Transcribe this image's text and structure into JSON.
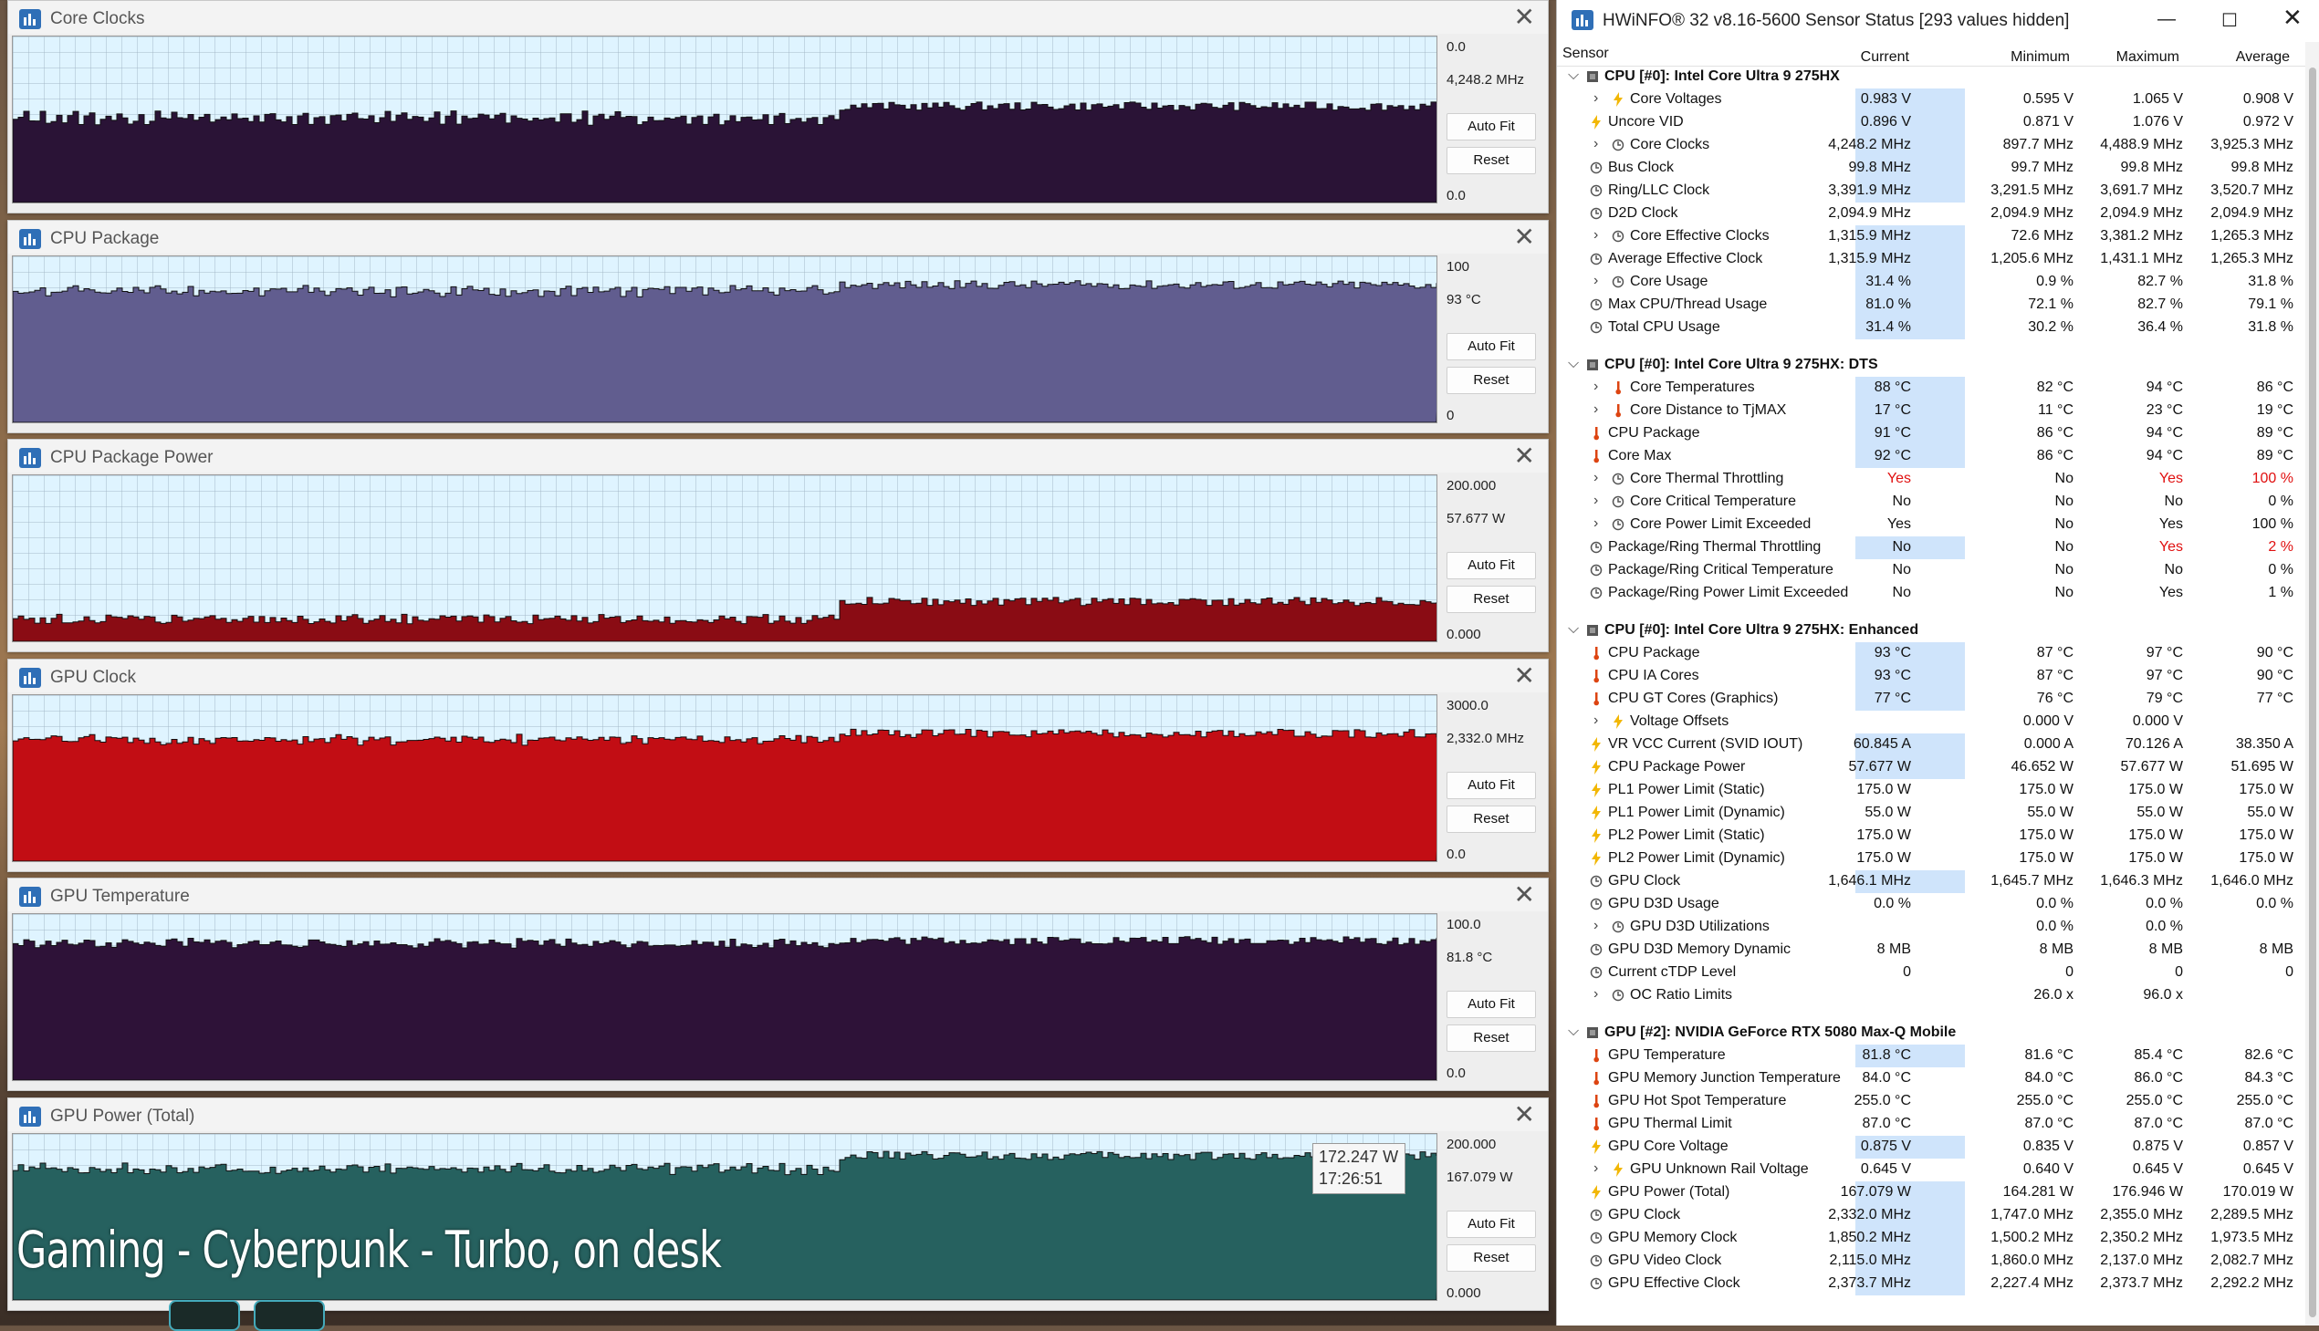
{
  "caption": "Gaming - Cyberpunk - Turbo, on desk",
  "graphs": [
    {
      "title": "Core Clocks",
      "max_label": "0.0",
      "current_label": "4,248.2 MHz",
      "min_label": "0.0",
      "fill": "#2a1336",
      "series": [
        0.49,
        0.51,
        0.53,
        0.5,
        0.58
      ]
    },
    {
      "title": "CPU Package",
      "max_label": "100",
      "current_label": "93 °C",
      "min_label": "0",
      "fill": "#615d8f",
      "series": [
        0.78,
        0.79,
        0.8,
        0.79,
        0.83
      ]
    },
    {
      "title": "CPU Package Power",
      "max_label": "200.000",
      "current_label": "57.677 W",
      "min_label": "0.000",
      "fill": "#8a0c14",
      "series": [
        0.13,
        0.13,
        0.14,
        0.13,
        0.24
      ]
    },
    {
      "title": "GPU Clock",
      "max_label": "3000.0",
      "current_label": "2,332.0 MHz",
      "min_label": "0.0",
      "fill": "#c20d14",
      "series": [
        0.72,
        0.73,
        0.74,
        0.73,
        0.77
      ]
    },
    {
      "title": "GPU Temperature",
      "max_label": "100.0",
      "current_label": "81.8 °C",
      "min_label": "0.0",
      "fill": "#2e1238",
      "series": [
        0.82,
        0.82,
        0.83,
        0.82,
        0.84
      ]
    },
    {
      "title": "GPU Power (Total)",
      "max_label": "200.000",
      "current_label": "167.079 W",
      "min_label": "0.000",
      "fill": "#26615f",
      "series": [
        0.78,
        0.79,
        0.8,
        0.78,
        0.87
      ]
    }
  ],
  "buttons": {
    "autofit": "Auto Fit",
    "reset": "Reset"
  },
  "tooltip": {
    "line1": "172.247 W",
    "line2": "17:26:51"
  },
  "hwinfo": {
    "title": "HWiNFO® 32 v8.16-5600 Sensor Status [293 values hidden]",
    "headers": {
      "sensor": "Sensor",
      "current": "Current",
      "minimum": "Minimum",
      "maximum": "Maximum",
      "average": "Average"
    },
    "rows": [
      {
        "g": 1,
        "name": "CPU [#0]: Intel Core Ultra 9 275HX"
      },
      {
        "e": 1,
        "ic": "bolt",
        "name": "Core Voltages",
        "c": "0.983 V",
        "mn": "0.595 V",
        "mx": "1.065 V",
        "av": "0.908 V",
        "hl": 1
      },
      {
        "ic": "bolt",
        "name": "Uncore VID",
        "c": "0.896 V",
        "mn": "0.871 V",
        "mx": "1.076 V",
        "av": "0.972 V",
        "hl": 1
      },
      {
        "e": 1,
        "ic": "clock",
        "name": "Core Clocks",
        "c": "4,248.2 MHz",
        "mn": "897.7 MHz",
        "mx": "4,488.9 MHz",
        "av": "3,925.3 MHz",
        "hl": 1
      },
      {
        "ic": "clock",
        "name": "Bus Clock",
        "c": "99.8 MHz",
        "mn": "99.7 MHz",
        "mx": "99.8 MHz",
        "av": "99.8 MHz",
        "hl": 1
      },
      {
        "ic": "clock",
        "name": "Ring/LLC Clock",
        "c": "3,391.9 MHz",
        "mn": "3,291.5 MHz",
        "mx": "3,691.7 MHz",
        "av": "3,520.7 MHz",
        "hl": 1
      },
      {
        "ic": "clock",
        "name": "D2D Clock",
        "c": "2,094.9 MHz",
        "mn": "2,094.9 MHz",
        "mx": "2,094.9 MHz",
        "av": "2,094.9 MHz"
      },
      {
        "e": 1,
        "ic": "clock",
        "name": "Core Effective Clocks",
        "c": "1,315.9 MHz",
        "mn": "72.6 MHz",
        "mx": "3,381.2 MHz",
        "av": "1,265.3 MHz",
        "hl": 1
      },
      {
        "ic": "clock",
        "name": "Average Effective Clock",
        "c": "1,315.9 MHz",
        "mn": "1,205.6 MHz",
        "mx": "1,431.1 MHz",
        "av": "1,265.3 MHz",
        "hl": 1
      },
      {
        "e": 1,
        "ic": "clock",
        "name": "Core Usage",
        "c": "31.4 %",
        "mn": "0.9 %",
        "mx": "82.7 %",
        "av": "31.8 %",
        "hl": 1
      },
      {
        "ic": "clock",
        "name": "Max CPU/Thread Usage",
        "c": "81.0 %",
        "mn": "72.1 %",
        "mx": "82.7 %",
        "av": "79.1 %",
        "hl": 1
      },
      {
        "ic": "clock",
        "name": "Total CPU Usage",
        "c": "31.4 %",
        "mn": "30.2 %",
        "mx": "36.4 %",
        "av": "31.8 %",
        "hl": 1
      },
      {
        "sp": 1
      },
      {
        "g": 1,
        "name": "CPU [#0]: Intel Core Ultra 9 275HX: DTS"
      },
      {
        "e": 1,
        "ic": "therm",
        "name": "Core Temperatures",
        "c": "88 °C",
        "mn": "82 °C",
        "mx": "94 °C",
        "av": "86 °C",
        "hl": 1
      },
      {
        "e": 1,
        "ic": "therm",
        "name": "Core Distance to TjMAX",
        "c": "17 °C",
        "mn": "11 °C",
        "mx": "23 °C",
        "av": "19 °C",
        "hl": 1
      },
      {
        "ic": "therm",
        "name": "CPU Package",
        "c": "91 °C",
        "mn": "86 °C",
        "mx": "94 °C",
        "av": "89 °C",
        "hl": 1
      },
      {
        "ic": "therm",
        "name": "Core Max",
        "c": "92 °C",
        "mn": "86 °C",
        "mx": "94 °C",
        "av": "89 °C",
        "hl": 1
      },
      {
        "e": 1,
        "ic": "clock",
        "name": "Core Thermal Throttling",
        "c": "Yes",
        "mn": "No",
        "mx": "Yes",
        "av": "100 %",
        "red": [
          1,
          0,
          1,
          1
        ]
      },
      {
        "e": 1,
        "ic": "clock",
        "name": "Core Critical Temperature",
        "c": "No",
        "mn": "No",
        "mx": "No",
        "av": "0 %"
      },
      {
        "e": 1,
        "ic": "clock",
        "name": "Core Power Limit Exceeded",
        "c": "Yes",
        "mn": "No",
        "mx": "Yes",
        "av": "100 %"
      },
      {
        "ic": "clock",
        "name": "Package/Ring Thermal Throttling",
        "c": "No",
        "mn": "No",
        "mx": "Yes",
        "av": "2 %",
        "hl": 1,
        "red": [
          0,
          0,
          1,
          1
        ]
      },
      {
        "ic": "clock",
        "name": "Package/Ring Critical Temperature",
        "c": "No",
        "mn": "No",
        "mx": "No",
        "av": "0 %"
      },
      {
        "ic": "clock",
        "name": "Package/Ring Power Limit Exceeded",
        "c": "No",
        "mn": "No",
        "mx": "Yes",
        "av": "1 %"
      },
      {
        "sp": 1
      },
      {
        "g": 1,
        "name": "CPU [#0]: Intel Core Ultra 9 275HX: Enhanced"
      },
      {
        "ic": "therm",
        "name": "CPU Package",
        "c": "93 °C",
        "mn": "87 °C",
        "mx": "97 °C",
        "av": "90 °C",
        "hl": 1
      },
      {
        "ic": "therm",
        "name": "CPU IA Cores",
        "c": "93 °C",
        "mn": "87 °C",
        "mx": "97 °C",
        "av": "90 °C",
        "hl": 1
      },
      {
        "ic": "therm",
        "name": "CPU GT Cores (Graphics)",
        "c": "77 °C",
        "mn": "76 °C",
        "mx": "79 °C",
        "av": "77 °C",
        "hl": 1
      },
      {
        "e": 1,
        "ic": "bolt",
        "name": "Voltage Offsets",
        "c": "",
        "mn": "0.000 V",
        "mx": "0.000 V",
        "av": ""
      },
      {
        "ic": "bolt",
        "name": "VR VCC Current (SVID IOUT)",
        "c": "60.845 A",
        "mn": "0.000 A",
        "mx": "70.126 A",
        "av": "38.350 A",
        "hl": 1
      },
      {
        "ic": "bolt",
        "name": "CPU Package Power",
        "c": "57.677 W",
        "mn": "46.652 W",
        "mx": "57.677 W",
        "av": "51.695 W",
        "hl": 1
      },
      {
        "ic": "bolt",
        "name": "PL1 Power Limit (Static)",
        "c": "175.0 W",
        "mn": "175.0 W",
        "mx": "175.0 W",
        "av": "175.0 W"
      },
      {
        "ic": "bolt",
        "name": "PL1 Power Limit (Dynamic)",
        "c": "55.0 W",
        "mn": "55.0 W",
        "mx": "55.0 W",
        "av": "55.0 W"
      },
      {
        "ic": "bolt",
        "name": "PL2 Power Limit (Static)",
        "c": "175.0 W",
        "mn": "175.0 W",
        "mx": "175.0 W",
        "av": "175.0 W"
      },
      {
        "ic": "bolt",
        "name": "PL2 Power Limit (Dynamic)",
        "c": "175.0 W",
        "mn": "175.0 W",
        "mx": "175.0 W",
        "av": "175.0 W"
      },
      {
        "ic": "clock",
        "name": "GPU Clock",
        "c": "1,646.1 MHz",
        "mn": "1,645.7 MHz",
        "mx": "1,646.3 MHz",
        "av": "1,646.0 MHz",
        "hl": 1
      },
      {
        "ic": "clock",
        "name": "GPU D3D Usage",
        "c": "0.0 %",
        "mn": "0.0 %",
        "mx": "0.0 %",
        "av": "0.0 %"
      },
      {
        "e": 1,
        "ic": "clock",
        "name": "GPU D3D Utilizations",
        "c": "",
        "mn": "0.0 %",
        "mx": "0.0 %",
        "av": ""
      },
      {
        "ic": "clock",
        "name": "GPU D3D Memory Dynamic",
        "c": "8 MB",
        "mn": "8 MB",
        "mx": "8 MB",
        "av": "8 MB"
      },
      {
        "ic": "clock",
        "name": "Current cTDP Level",
        "c": "0",
        "mn": "0",
        "mx": "0",
        "av": "0"
      },
      {
        "e": 1,
        "ic": "clock",
        "name": "OC Ratio Limits",
        "c": "",
        "mn": "26.0 x",
        "mx": "96.0 x",
        "av": ""
      },
      {
        "sp": 1
      },
      {
        "g": 1,
        "name": "GPU [#2]: NVIDIA  GeForce RTX 5080 Max-Q Mobile"
      },
      {
        "ic": "therm",
        "name": "GPU Temperature",
        "c": "81.8 °C",
        "mn": "81.6 °C",
        "mx": "85.4 °C",
        "av": "82.6 °C",
        "hl": 1
      },
      {
        "ic": "therm",
        "name": "GPU Memory Junction Temperature",
        "c": "84.0 °C",
        "mn": "84.0 °C",
        "mx": "86.0 °C",
        "av": "84.3 °C"
      },
      {
        "ic": "therm",
        "name": "GPU Hot Spot Temperature",
        "c": "255.0 °C",
        "mn": "255.0 °C",
        "mx": "255.0 °C",
        "av": "255.0 °C"
      },
      {
        "ic": "therm",
        "name": "GPU Thermal Limit",
        "c": "87.0 °C",
        "mn": "87.0 °C",
        "mx": "87.0 °C",
        "av": "87.0 °C"
      },
      {
        "ic": "bolt",
        "name": "GPU Core Voltage",
        "c": "0.875 V",
        "mn": "0.835 V",
        "mx": "0.875 V",
        "av": "0.857 V",
        "hl": 1
      },
      {
        "e": 1,
        "ic": "bolt",
        "name": "GPU Unknown Rail Voltage",
        "c": "0.645 V",
        "mn": "0.640 V",
        "mx": "0.645 V",
        "av": "0.645 V"
      },
      {
        "ic": "bolt",
        "name": "GPU Power (Total)",
        "c": "167.079 W",
        "mn": "164.281 W",
        "mx": "176.946 W",
        "av": "170.019 W",
        "hl": 1
      },
      {
        "ic": "clock",
        "name": "GPU Clock",
        "c": "2,332.0 MHz",
        "mn": "1,747.0 MHz",
        "mx": "2,355.0 MHz",
        "av": "2,289.5 MHz",
        "hl": 1
      },
      {
        "ic": "clock",
        "name": "GPU Memory Clock",
        "c": "1,850.2 MHz",
        "mn": "1,500.2 MHz",
        "mx": "2,350.2 MHz",
        "av": "1,973.5 MHz",
        "hl": 1
      },
      {
        "ic": "clock",
        "name": "GPU Video Clock",
        "c": "2,115.0 MHz",
        "mn": "1,860.0 MHz",
        "mx": "2,137.0 MHz",
        "av": "2,082.7 MHz",
        "hl": 1
      },
      {
        "ic": "clock",
        "name": "GPU Effective Clock",
        "c": "2,373.7 MHz",
        "mn": "2,227.4 MHz",
        "mx": "2,373.7 MHz",
        "av": "2,292.2 MHz",
        "hl": 1
      }
    ]
  }
}
